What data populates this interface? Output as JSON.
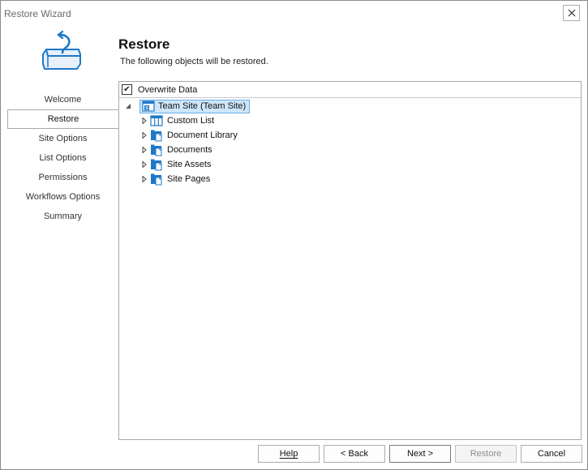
{
  "window": {
    "title": "Restore Wizard",
    "close_glyph": "✕"
  },
  "header": {
    "icon": "restore-box-icon",
    "title": "Restore",
    "subtitle": "The following objects will be restored."
  },
  "nav": {
    "items": [
      {
        "label": "Welcome",
        "active": false
      },
      {
        "label": "Restore",
        "active": true
      },
      {
        "label": "Site Options",
        "active": false
      },
      {
        "label": "List Options",
        "active": false
      },
      {
        "label": "Permissions",
        "active": false
      },
      {
        "label": "Workflows Options",
        "active": false
      },
      {
        "label": "Summary",
        "active": false
      }
    ]
  },
  "overwrite": {
    "label": "Overwrite Data",
    "checked": true,
    "check_glyph": "✔"
  },
  "tree": {
    "root": {
      "label": "Team Site (Team Site)",
      "expanded": true,
      "icon": "sharepoint-site-icon"
    },
    "children": [
      {
        "label": "Custom List",
        "icon": "list-icon"
      },
      {
        "label": "Document Library",
        "icon": "library-icon"
      },
      {
        "label": "Documents",
        "icon": "library-icon"
      },
      {
        "label": "Site Assets",
        "icon": "library-icon"
      },
      {
        "label": "Site Pages",
        "icon": "library-icon"
      }
    ]
  },
  "buttons": {
    "help": "Help",
    "back": "< Back",
    "next": "Next >",
    "restore": "Restore",
    "cancel": "Cancel"
  },
  "colors": {
    "accent": "#1e78c8",
    "selection_bg": "#cde6fb",
    "selection_border": "#6aaee8"
  }
}
